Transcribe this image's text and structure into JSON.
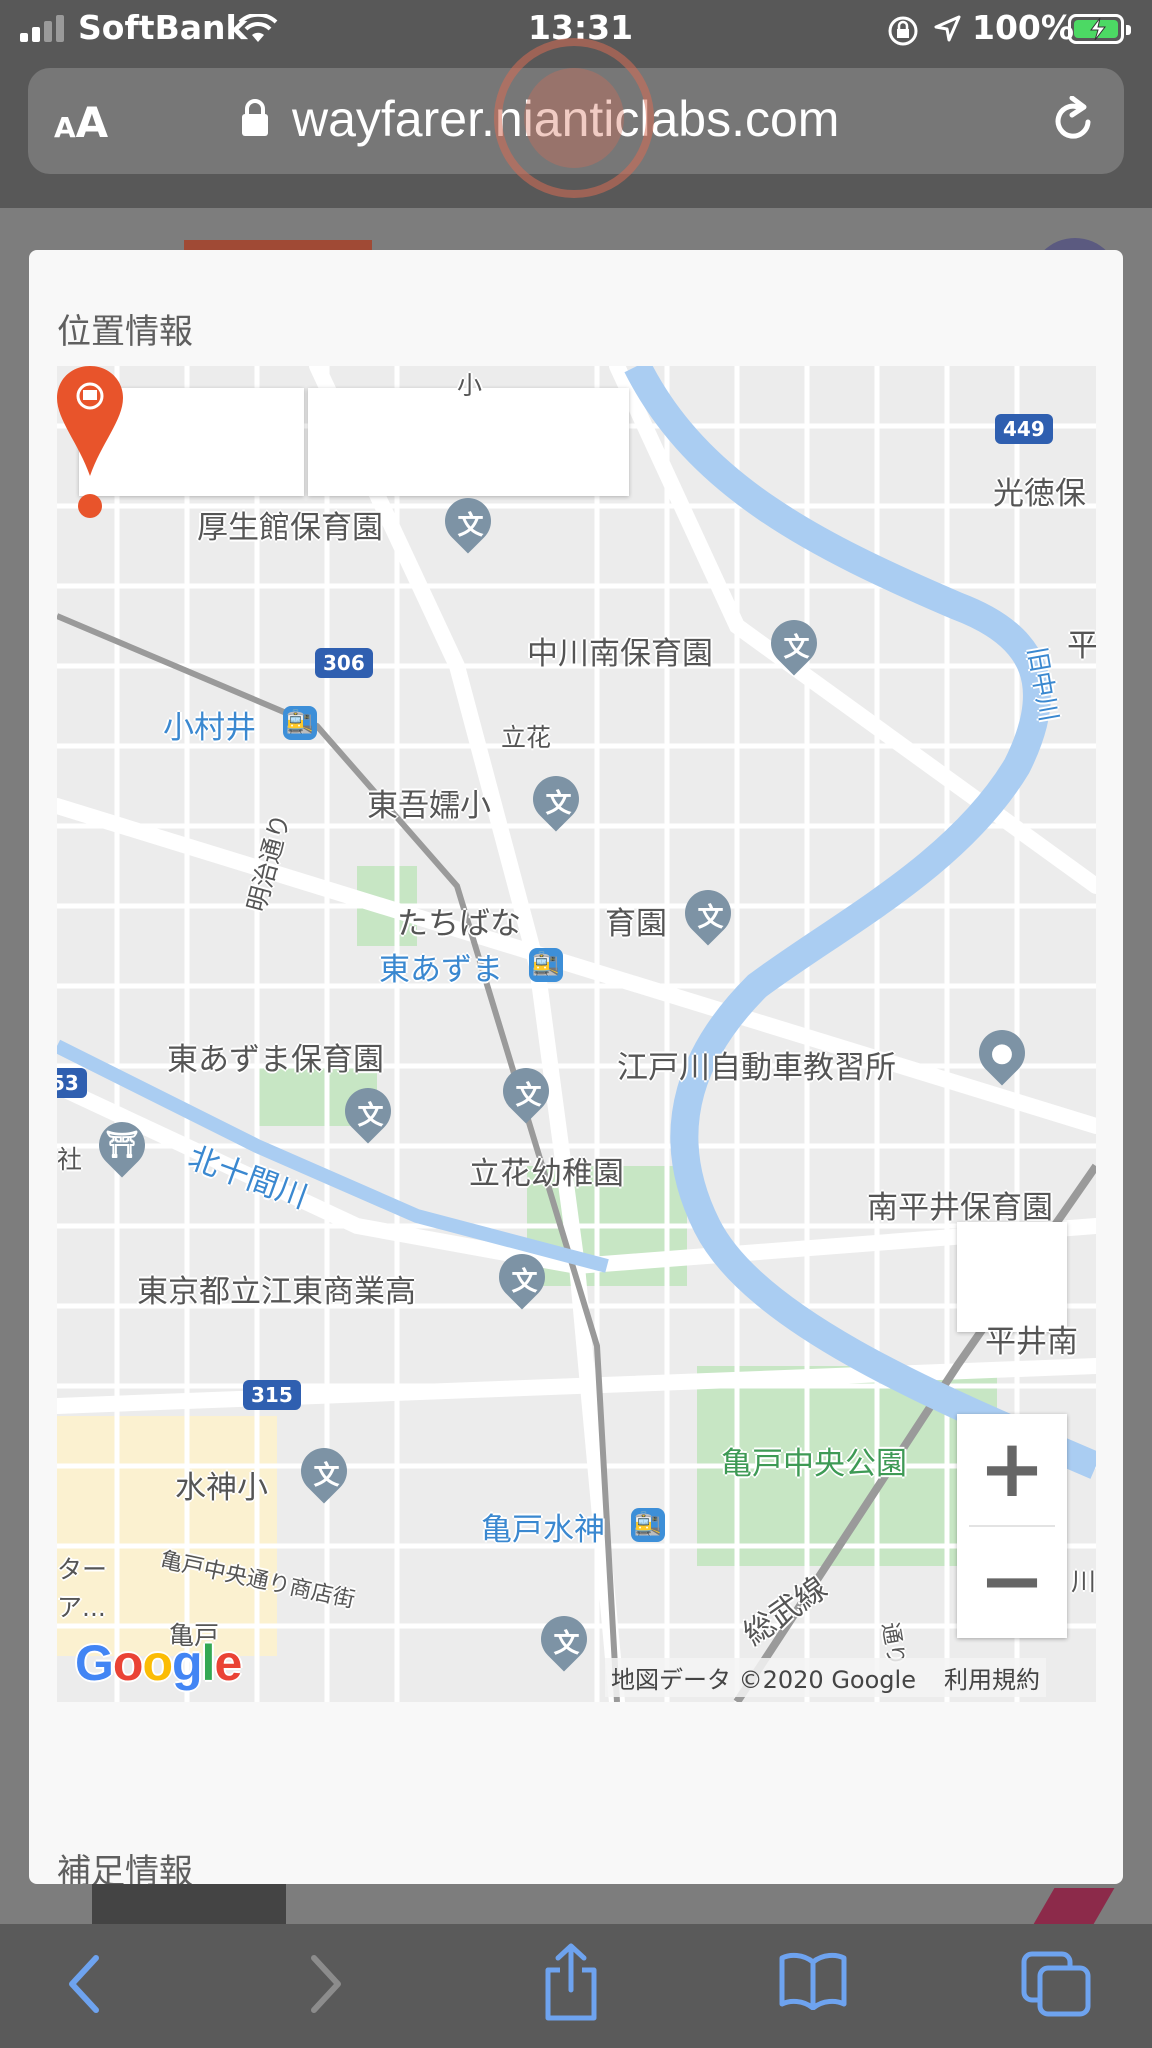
{
  "status_bar": {
    "carrier": "SoftBank",
    "time": "13:31",
    "battery_percent": "100%",
    "battery_charging": true
  },
  "url_bar": {
    "text_size_label_small": "A",
    "text_size_label_large": "A",
    "url": "wayfarer.nianticlabs.com"
  },
  "modal": {
    "location_heading": "位置情報",
    "extra_heading": "補足情報"
  },
  "map": {
    "labels": {
      "kouseikan": "厚生館保育園",
      "nakagawa_minami": "中川南保育園",
      "komurai": "小村井",
      "tachibana": "立花",
      "higashi_azuma_elem": "東吾嬬小",
      "meiji_dori": "明治通り",
      "tachibana_nursery": "たちばな",
      "tachibana_nursery_suffix": "育園",
      "higashi_azuma_station": "東あずま",
      "higashi_azuma_nursery": "東あずま保育園",
      "edogawa_driving": "江戸川自動車教習所",
      "kitajukken_river": "北十間川",
      "tachibana_kindergarten": "立花幼稚園",
      "minami_hirai_nursery": "南平井保育園",
      "koto_commercial": "東京都立江東商業高",
      "hirai_minami": "平井南",
      "suijin_elem": "水神小",
      "kameido_suijin": "亀戸水神",
      "kameido_central_park": "亀戸中央公園",
      "kameido_chuo_dori": "亀戸中央通り商店街",
      "kameido": "亀戸",
      "sobu_line": "総武線",
      "kotoku": "光徳保",
      "hira": "平",
      "kyu_nakagawa": "旧中川",
      "sha": "社",
      "ta": "ター",
      "a_ellipsis": "ア...",
      "elem_top": "小",
      "dori": "通り",
      "kawa": "川"
    },
    "route_shields": [
      "449",
      "306",
      "315"
    ],
    "route_shield_left": "53",
    "google_logo": "Google",
    "attribution": "地図データ ©2020 Google",
    "terms_link": "利用規約",
    "zoom_in": "+",
    "zoom_out": "−",
    "colors": {
      "water": "#aacdf2",
      "park": "#c7e6c4",
      "road": "#ffffff",
      "land": "#ececec",
      "pin": "#e8542b",
      "poi": "#7d93a5",
      "station": "#3d8fd8",
      "shield": "#2f5fb0"
    }
  },
  "toolbar": {
    "icons": [
      "back-icon",
      "forward-icon",
      "share-icon",
      "bookmarks-icon",
      "tabs-icon"
    ]
  }
}
